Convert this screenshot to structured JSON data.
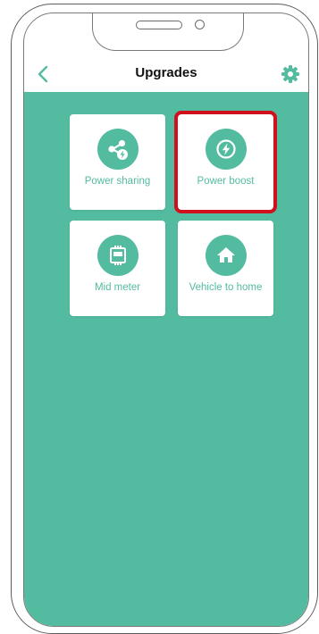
{
  "header": {
    "title": "Upgrades"
  },
  "tiles": [
    {
      "label": "Power sharing",
      "icon": "share-bolt-icon"
    },
    {
      "label": "Power boost",
      "icon": "bolt-icon",
      "highlighted": true
    },
    {
      "label": "Mid meter",
      "icon": "meter-icon"
    },
    {
      "label": "Vehicle to home",
      "icon": "home-icon"
    }
  ],
  "colors": {
    "accent": "#52bba0",
    "highlight": "#d0101c"
  }
}
